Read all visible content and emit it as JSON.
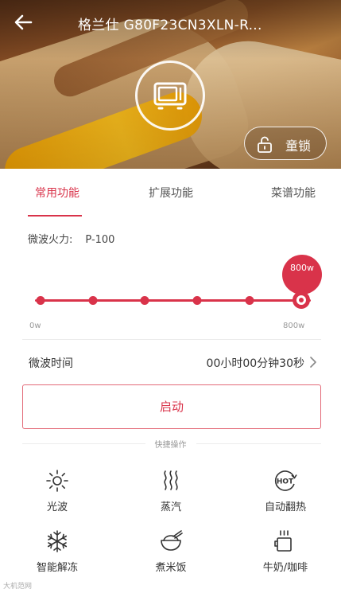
{
  "header": {
    "title": "格兰仕 G80F23CN3XLN-R...",
    "lock_label": "童锁"
  },
  "tabs": [
    {
      "label": "常用功能",
      "active": true
    },
    {
      "label": "扩展功能",
      "active": false
    },
    {
      "label": "菜谱功能",
      "active": false
    }
  ],
  "power": {
    "label": "微波火力:",
    "value": "P-100",
    "bubble": "800w",
    "min_label": "0w",
    "max_label": "800w",
    "level_fraction": 1.0,
    "steps": 6
  },
  "time": {
    "label": "微波时间",
    "value": "00小时00分钟30秒"
  },
  "start_label": "启动",
  "quick": {
    "title": "快捷操作",
    "items": [
      {
        "label": "光波",
        "icon": "sun-icon"
      },
      {
        "label": "蒸汽",
        "icon": "steam-icon"
      },
      {
        "label": "自动翻热",
        "icon": "hot-icon",
        "icon_text": "HOT"
      },
      {
        "label": "智能解冻",
        "icon": "snowflake-icon"
      },
      {
        "label": "煮米饭",
        "icon": "rice-bowl-icon"
      },
      {
        "label": "牛奶/咖啡",
        "icon": "cup-icon"
      }
    ]
  },
  "watermark": "大机范网",
  "colors": {
    "accent": "#d9334a",
    "text": "#333333",
    "muted": "#999999"
  }
}
